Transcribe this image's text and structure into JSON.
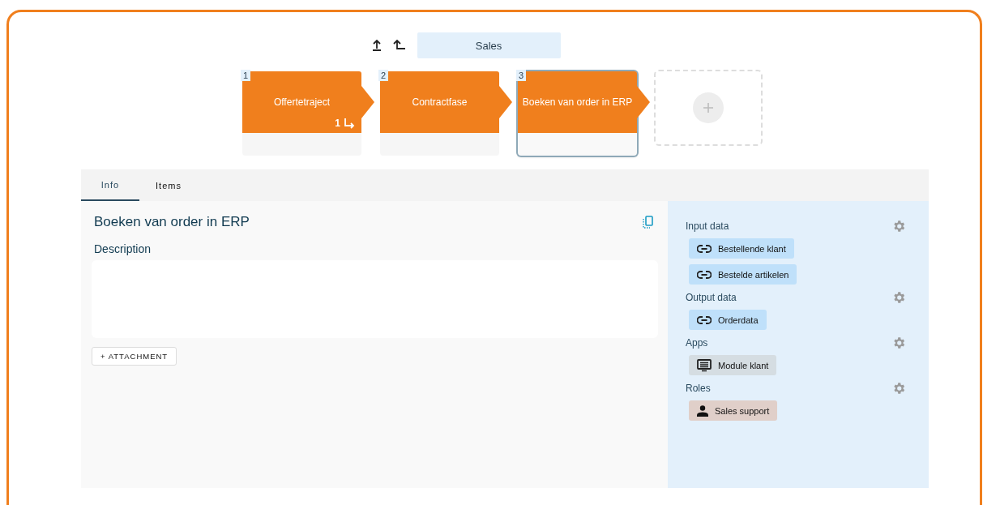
{
  "breadcrumb": {
    "title": "Sales"
  },
  "steps": [
    {
      "number": "1",
      "label": "Offertetraject",
      "selected": false,
      "subprocess_count": "1"
    },
    {
      "number": "2",
      "label": "Contractfase",
      "selected": false
    },
    {
      "number": "3",
      "label": "Boeken van order in ERP",
      "selected": true
    }
  ],
  "tabs": [
    {
      "label": "Info",
      "selected": true
    },
    {
      "label": "Items",
      "selected": false
    }
  ],
  "detail": {
    "title": "Boeken van order in ERP",
    "description_label": "Description",
    "attachment_button": "+ ATTACHMENT"
  },
  "sections": [
    {
      "title": "Input data",
      "chips": [
        {
          "kind": "link",
          "label": "Bestellende klant"
        },
        {
          "kind": "link",
          "label": "Bestelde artikelen"
        }
      ]
    },
    {
      "title": "Output data",
      "chips": [
        {
          "kind": "link",
          "label": "Orderdata"
        }
      ]
    },
    {
      "title": "Apps",
      "chips": [
        {
          "kind": "app",
          "label": "Module klant"
        }
      ]
    },
    {
      "title": "Roles",
      "chips": [
        {
          "kind": "role",
          "label": "Sales support"
        }
      ]
    }
  ]
}
